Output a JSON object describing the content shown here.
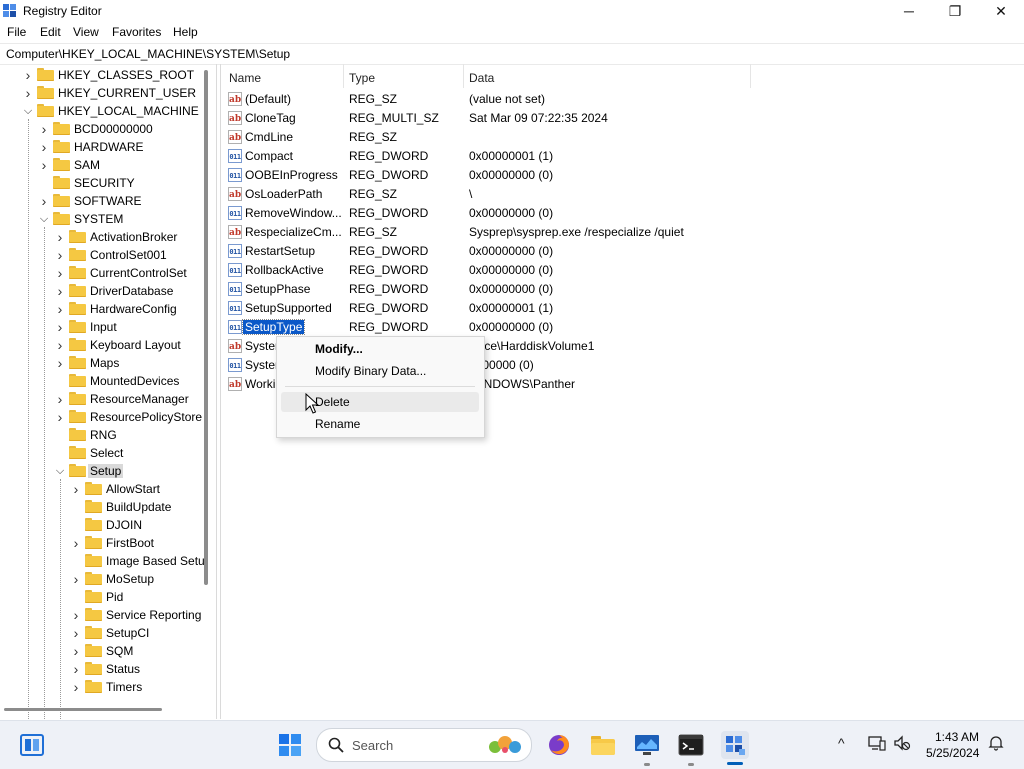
{
  "window": {
    "title": "Registry Editor",
    "controls": {
      "minimize": "─",
      "maximize": "❐",
      "close": "✕"
    }
  },
  "menu": [
    "File",
    "Edit",
    "View",
    "Favorites",
    "Help"
  ],
  "address": "Computer\\HKEY_LOCAL_MACHINE\\SYSTEM\\Setup",
  "tree": [
    {
      "label": "HKEY_CLASSES_ROOT",
      "expanded": false
    },
    {
      "label": "HKEY_CURRENT_USER",
      "expanded": false
    },
    {
      "label": "HKEY_LOCAL_MACHINE",
      "expanded": true
    },
    {
      "label": "BCD00000000",
      "expanded": false
    },
    {
      "label": "HARDWARE",
      "expanded": false
    },
    {
      "label": "SAM",
      "expanded": false
    },
    {
      "label": "SECURITY",
      "expanded": false
    },
    {
      "label": "SOFTWARE",
      "expanded": false
    },
    {
      "label": "SYSTEM",
      "expanded": true
    },
    {
      "label": "ActivationBroker",
      "expanded": false
    },
    {
      "label": "ControlSet001",
      "expanded": false
    },
    {
      "label": "CurrentControlSet",
      "expanded": false
    },
    {
      "label": "DriverDatabase",
      "expanded": false
    },
    {
      "label": "HardwareConfig",
      "expanded": false
    },
    {
      "label": "Input",
      "expanded": false
    },
    {
      "label": "Keyboard Layout",
      "expanded": false
    },
    {
      "label": "Maps",
      "expanded": false
    },
    {
      "label": "MountedDevices",
      "expanded": false
    },
    {
      "label": "ResourceManager",
      "expanded": false
    },
    {
      "label": "ResourcePolicyStore",
      "expanded": false
    },
    {
      "label": "RNG",
      "expanded": false
    },
    {
      "label": "Select",
      "expanded": false
    },
    {
      "label": "Setup",
      "expanded": true,
      "selected": true
    },
    {
      "label": "AllowStart",
      "expanded": false
    },
    {
      "label": "BuildUpdate",
      "expanded": false
    },
    {
      "label": "DJOIN",
      "expanded": false
    },
    {
      "label": "FirstBoot",
      "expanded": false
    },
    {
      "label": "Image Based Setu",
      "expanded": false
    },
    {
      "label": "MoSetup",
      "expanded": false
    },
    {
      "label": "Pid",
      "expanded": false
    },
    {
      "label": "Service Reporting",
      "expanded": false
    },
    {
      "label": "SetupCI",
      "expanded": false
    },
    {
      "label": "SQM",
      "expanded": false
    },
    {
      "label": "Status",
      "expanded": false
    },
    {
      "label": "Timers",
      "expanded": false
    }
  ],
  "columns": {
    "name": "Name",
    "type": "Type",
    "data": "Data"
  },
  "values": [
    {
      "name": "(Default)",
      "type": "REG_SZ",
      "data": "(value not set)",
      "icon": "ab"
    },
    {
      "name": "CloneTag",
      "type": "REG_MULTI_SZ",
      "data": "Sat Mar 09 07:22:35 2024",
      "icon": "ab"
    },
    {
      "name": "CmdLine",
      "type": "REG_SZ",
      "data": "",
      "icon": "ab"
    },
    {
      "name": "Compact",
      "type": "REG_DWORD",
      "data": "0x00000001 (1)",
      "icon": "bin"
    },
    {
      "name": "OOBEInProgress",
      "type": "REG_DWORD",
      "data": "0x00000000 (0)",
      "icon": "bin"
    },
    {
      "name": "OsLoaderPath",
      "type": "REG_SZ",
      "data": "\\",
      "icon": "ab"
    },
    {
      "name": "RemoveWindow...",
      "type": "REG_DWORD",
      "data": "0x00000000 (0)",
      "icon": "bin"
    },
    {
      "name": "RespecializeCm...",
      "type": "REG_SZ",
      "data": "Sysprep\\sysprep.exe /respecialize /quiet",
      "icon": "ab"
    },
    {
      "name": "RestartSetup",
      "type": "REG_DWORD",
      "data": "0x00000000 (0)",
      "icon": "bin"
    },
    {
      "name": "RollbackActive",
      "type": "REG_DWORD",
      "data": "0x00000000 (0)",
      "icon": "bin"
    },
    {
      "name": "SetupPhase",
      "type": "REG_DWORD",
      "data": "0x00000000 (0)",
      "icon": "bin"
    },
    {
      "name": "SetupSupported",
      "type": "REG_DWORD",
      "data": "0x00000001 (1)",
      "icon": "bin"
    },
    {
      "name": "SetupType",
      "type": "REG_DWORD",
      "data": "0x00000000 (0)",
      "icon": "bin",
      "selected": true
    },
    {
      "name": "Syster",
      "type": "",
      "data": "evice\\HarddiskVolume1",
      "icon": "ab"
    },
    {
      "name": "Syster",
      "type": "",
      "data": "0000000 (0)",
      "icon": "bin"
    },
    {
      "name": "Worki",
      "type": "",
      "data": "WINDOWS\\Panther",
      "icon": "ab"
    }
  ],
  "context_menu": {
    "modify": "Modify...",
    "modify_binary": "Modify Binary Data...",
    "delete": "Delete",
    "rename": "Rename"
  },
  "taskbar": {
    "search_placeholder": "Search",
    "time": "1:43 AM",
    "date": "5/25/2024",
    "icons": [
      "widgets-icon",
      "start-icon",
      "search-icon",
      "firefox-icon",
      "file-explorer-icon",
      "monitor-app-icon",
      "terminal-icon",
      "registry-editor-icon"
    ],
    "tray": [
      "chevron-up-icon",
      "network-icon",
      "volume-mute-icon",
      "notifications-icon"
    ]
  },
  "colors": {
    "accent": "#005fb8",
    "selection": "#0a58c8",
    "folder": "#f5c842"
  }
}
